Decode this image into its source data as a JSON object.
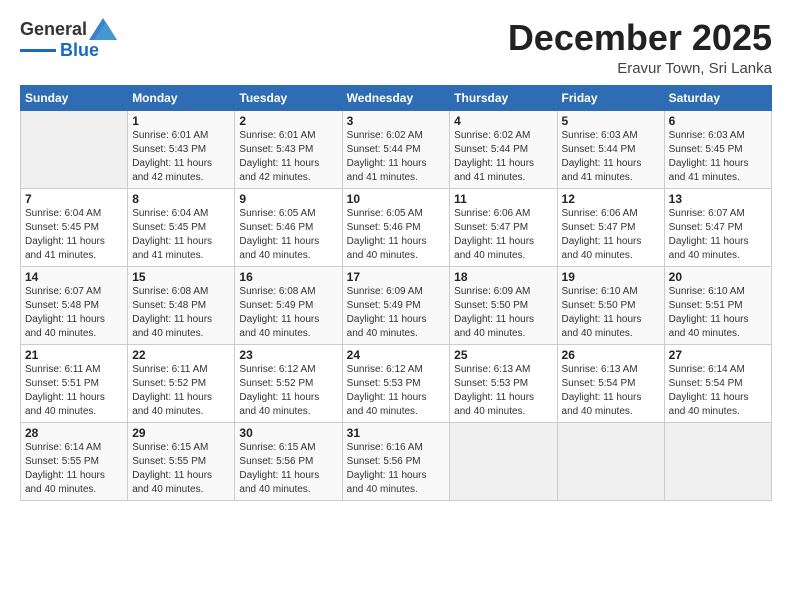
{
  "logo": {
    "general": "General",
    "blue": "Blue"
  },
  "title": "December 2025",
  "location": "Eravur Town, Sri Lanka",
  "days_header": [
    "Sunday",
    "Monday",
    "Tuesday",
    "Wednesday",
    "Thursday",
    "Friday",
    "Saturday"
  ],
  "weeks": [
    [
      {
        "day": "",
        "sunrise": "",
        "sunset": "",
        "daylight": ""
      },
      {
        "day": "1",
        "sunrise": "Sunrise: 6:01 AM",
        "sunset": "Sunset: 5:43 PM",
        "daylight": "Daylight: 11 hours and 42 minutes."
      },
      {
        "day": "2",
        "sunrise": "Sunrise: 6:01 AM",
        "sunset": "Sunset: 5:43 PM",
        "daylight": "Daylight: 11 hours and 42 minutes."
      },
      {
        "day": "3",
        "sunrise": "Sunrise: 6:02 AM",
        "sunset": "Sunset: 5:44 PM",
        "daylight": "Daylight: 11 hours and 41 minutes."
      },
      {
        "day": "4",
        "sunrise": "Sunrise: 6:02 AM",
        "sunset": "Sunset: 5:44 PM",
        "daylight": "Daylight: 11 hours and 41 minutes."
      },
      {
        "day": "5",
        "sunrise": "Sunrise: 6:03 AM",
        "sunset": "Sunset: 5:44 PM",
        "daylight": "Daylight: 11 hours and 41 minutes."
      },
      {
        "day": "6",
        "sunrise": "Sunrise: 6:03 AM",
        "sunset": "Sunset: 5:45 PM",
        "daylight": "Daylight: 11 hours and 41 minutes."
      }
    ],
    [
      {
        "day": "7",
        "sunrise": "Sunrise: 6:04 AM",
        "sunset": "Sunset: 5:45 PM",
        "daylight": "Daylight: 11 hours and 41 minutes."
      },
      {
        "day": "8",
        "sunrise": "Sunrise: 6:04 AM",
        "sunset": "Sunset: 5:45 PM",
        "daylight": "Daylight: 11 hours and 41 minutes."
      },
      {
        "day": "9",
        "sunrise": "Sunrise: 6:05 AM",
        "sunset": "Sunset: 5:46 PM",
        "daylight": "Daylight: 11 hours and 40 minutes."
      },
      {
        "day": "10",
        "sunrise": "Sunrise: 6:05 AM",
        "sunset": "Sunset: 5:46 PM",
        "daylight": "Daylight: 11 hours and 40 minutes."
      },
      {
        "day": "11",
        "sunrise": "Sunrise: 6:06 AM",
        "sunset": "Sunset: 5:47 PM",
        "daylight": "Daylight: 11 hours and 40 minutes."
      },
      {
        "day": "12",
        "sunrise": "Sunrise: 6:06 AM",
        "sunset": "Sunset: 5:47 PM",
        "daylight": "Daylight: 11 hours and 40 minutes."
      },
      {
        "day": "13",
        "sunrise": "Sunrise: 6:07 AM",
        "sunset": "Sunset: 5:47 PM",
        "daylight": "Daylight: 11 hours and 40 minutes."
      }
    ],
    [
      {
        "day": "14",
        "sunrise": "Sunrise: 6:07 AM",
        "sunset": "Sunset: 5:48 PM",
        "daylight": "Daylight: 11 hours and 40 minutes."
      },
      {
        "day": "15",
        "sunrise": "Sunrise: 6:08 AM",
        "sunset": "Sunset: 5:48 PM",
        "daylight": "Daylight: 11 hours and 40 minutes."
      },
      {
        "day": "16",
        "sunrise": "Sunrise: 6:08 AM",
        "sunset": "Sunset: 5:49 PM",
        "daylight": "Daylight: 11 hours and 40 minutes."
      },
      {
        "day": "17",
        "sunrise": "Sunrise: 6:09 AM",
        "sunset": "Sunset: 5:49 PM",
        "daylight": "Daylight: 11 hours and 40 minutes."
      },
      {
        "day": "18",
        "sunrise": "Sunrise: 6:09 AM",
        "sunset": "Sunset: 5:50 PM",
        "daylight": "Daylight: 11 hours and 40 minutes."
      },
      {
        "day": "19",
        "sunrise": "Sunrise: 6:10 AM",
        "sunset": "Sunset: 5:50 PM",
        "daylight": "Daylight: 11 hours and 40 minutes."
      },
      {
        "day": "20",
        "sunrise": "Sunrise: 6:10 AM",
        "sunset": "Sunset: 5:51 PM",
        "daylight": "Daylight: 11 hours and 40 minutes."
      }
    ],
    [
      {
        "day": "21",
        "sunrise": "Sunrise: 6:11 AM",
        "sunset": "Sunset: 5:51 PM",
        "daylight": "Daylight: 11 hours and 40 minutes."
      },
      {
        "day": "22",
        "sunrise": "Sunrise: 6:11 AM",
        "sunset": "Sunset: 5:52 PM",
        "daylight": "Daylight: 11 hours and 40 minutes."
      },
      {
        "day": "23",
        "sunrise": "Sunrise: 6:12 AM",
        "sunset": "Sunset: 5:52 PM",
        "daylight": "Daylight: 11 hours and 40 minutes."
      },
      {
        "day": "24",
        "sunrise": "Sunrise: 6:12 AM",
        "sunset": "Sunset: 5:53 PM",
        "daylight": "Daylight: 11 hours and 40 minutes."
      },
      {
        "day": "25",
        "sunrise": "Sunrise: 6:13 AM",
        "sunset": "Sunset: 5:53 PM",
        "daylight": "Daylight: 11 hours and 40 minutes."
      },
      {
        "day": "26",
        "sunrise": "Sunrise: 6:13 AM",
        "sunset": "Sunset: 5:54 PM",
        "daylight": "Daylight: 11 hours and 40 minutes."
      },
      {
        "day": "27",
        "sunrise": "Sunrise: 6:14 AM",
        "sunset": "Sunset: 5:54 PM",
        "daylight": "Daylight: 11 hours and 40 minutes."
      }
    ],
    [
      {
        "day": "28",
        "sunrise": "Sunrise: 6:14 AM",
        "sunset": "Sunset: 5:55 PM",
        "daylight": "Daylight: 11 hours and 40 minutes."
      },
      {
        "day": "29",
        "sunrise": "Sunrise: 6:15 AM",
        "sunset": "Sunset: 5:55 PM",
        "daylight": "Daylight: 11 hours and 40 minutes."
      },
      {
        "day": "30",
        "sunrise": "Sunrise: 6:15 AM",
        "sunset": "Sunset: 5:56 PM",
        "daylight": "Daylight: 11 hours and 40 minutes."
      },
      {
        "day": "31",
        "sunrise": "Sunrise: 6:16 AM",
        "sunset": "Sunset: 5:56 PM",
        "daylight": "Daylight: 11 hours and 40 minutes."
      },
      {
        "day": "",
        "sunrise": "",
        "sunset": "",
        "daylight": ""
      },
      {
        "day": "",
        "sunrise": "",
        "sunset": "",
        "daylight": ""
      },
      {
        "day": "",
        "sunrise": "",
        "sunset": "",
        "daylight": ""
      }
    ]
  ]
}
